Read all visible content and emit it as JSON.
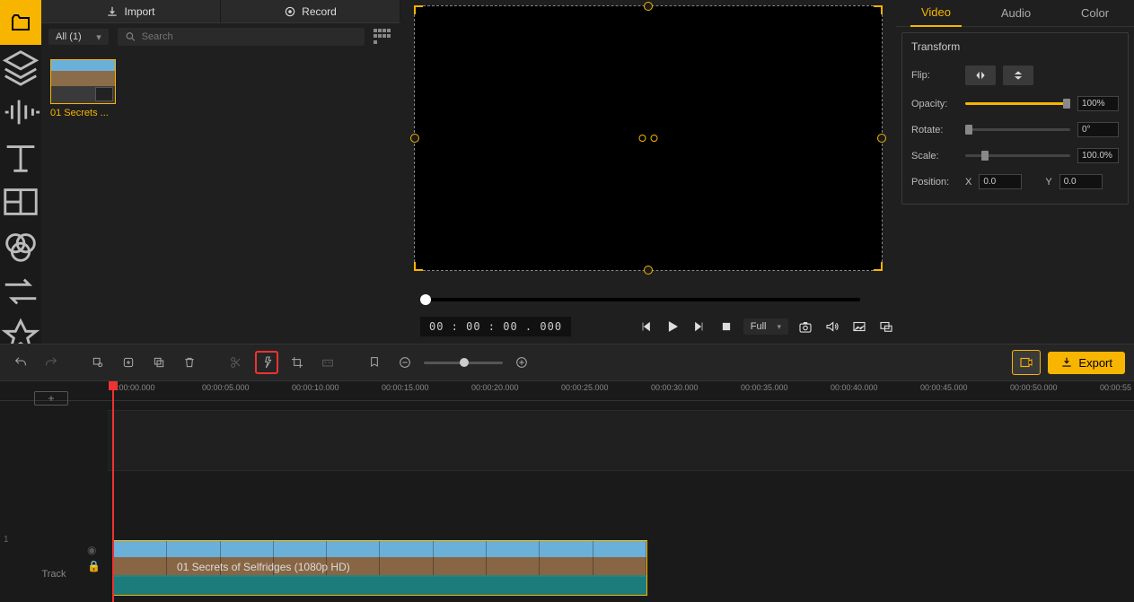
{
  "leftRail": [
    "media",
    "layers",
    "audio",
    "text",
    "split",
    "filters",
    "transitions",
    "elements"
  ],
  "lib": {
    "tabs": {
      "import": "Import",
      "record": "Record"
    },
    "filter": "All (1)",
    "searchPlaceholder": "Search",
    "clip": {
      "name": "01 Secrets ..."
    }
  },
  "preview": {
    "timecode": "00 : 00 : 00 . 000",
    "ratio": "Full"
  },
  "props": {
    "tabs": {
      "video": "Video",
      "audio": "Audio",
      "color": "Color"
    },
    "section": "Transform",
    "flipLabel": "Flip:",
    "opacityLabel": "Opacity:",
    "opacityValue": "100%",
    "rotateLabel": "Rotate:",
    "rotateValue": "0°",
    "scaleLabel": "Scale:",
    "scaleValue": "100.0%",
    "positionLabel": "Position:",
    "xLabel": "X",
    "xValue": "0.0",
    "yLabel": "Y",
    "yValue": "0.0"
  },
  "toolbar": {
    "export": "Export"
  },
  "timeline": {
    "marks": [
      "0:00:00.000",
      "00:00:05.000",
      "00:00:10.000",
      "00:00:15.000",
      "00:00:20.000",
      "00:00:25.000",
      "00:00:30.000",
      "00:00:35.000",
      "00:00:40.000",
      "00:00:45.000",
      "00:00:50.000",
      "00:00:55"
    ],
    "trackNum": "1",
    "trackLabel": "Track",
    "clipTitle": "01 Secrets of Selfridges (1080p HD)"
  }
}
